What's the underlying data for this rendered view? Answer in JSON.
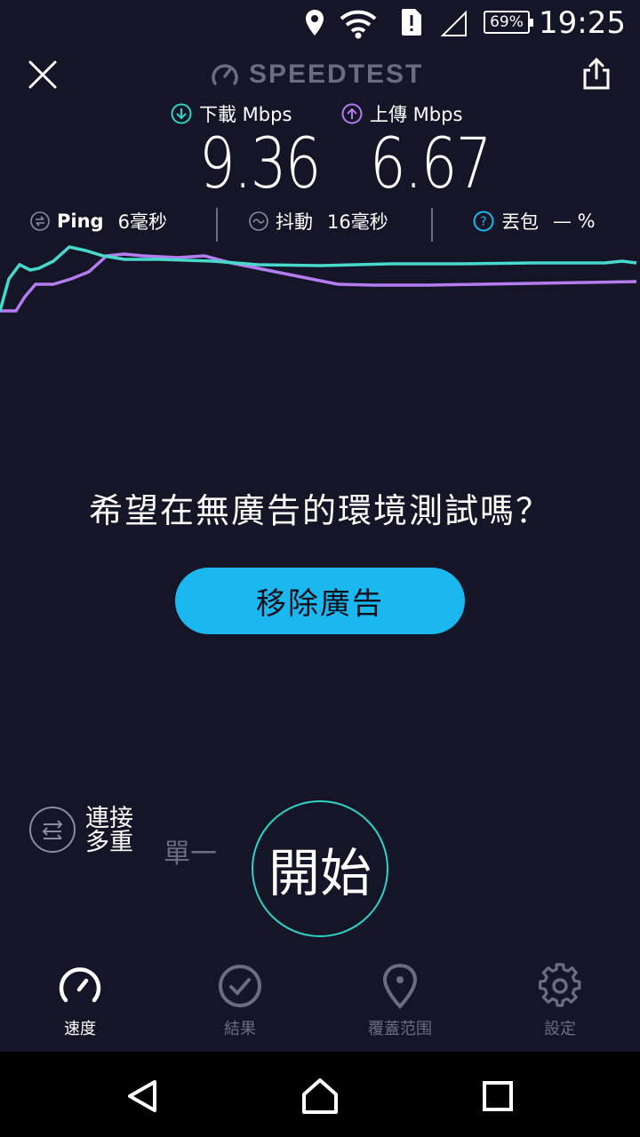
{
  "status_bar": {
    "battery": "69%",
    "time": "19:25",
    "icons": [
      "location-icon",
      "wifi-icon",
      "sim-alert-icon",
      "signal-icon",
      "battery-icon"
    ]
  },
  "header": {
    "logo_text": "SPEEDTEST"
  },
  "speeds": {
    "download": {
      "label": "下載 Mbps",
      "value": "9.36",
      "color": "#2ed3c6"
    },
    "upload": {
      "label": "上傳 Mbps",
      "value": "6.67",
      "color": "#b57cf0"
    }
  },
  "metrics": {
    "ping": {
      "label": "Ping",
      "value": "6毫秒"
    },
    "jitter": {
      "label": "抖動",
      "value": "16毫秒"
    },
    "loss": {
      "label": "丟包",
      "value": "— %"
    }
  },
  "promo": {
    "question": "希望在無廣告的環境測試嗎？",
    "button": "移除廣告"
  },
  "connection": {
    "multi": "連接 多重",
    "multi_line1": "連接",
    "multi_line2": "多重",
    "single": "單一"
  },
  "start_button": "開始",
  "nav": {
    "items": [
      {
        "label": "速度",
        "icon": "gauge-icon",
        "active": true
      },
      {
        "label": "結果",
        "icon": "check-circle-icon",
        "active": false
      },
      {
        "label": "覆蓋范围",
        "icon": "map-pin-icon",
        "active": false
      },
      {
        "label": "設定",
        "icon": "gear-icon",
        "active": false
      }
    ]
  },
  "colors": {
    "background": "#141526",
    "accent_teal": "#2ed3c6",
    "accent_purple": "#b57cf0",
    "button_blue": "#1ab8ee"
  }
}
